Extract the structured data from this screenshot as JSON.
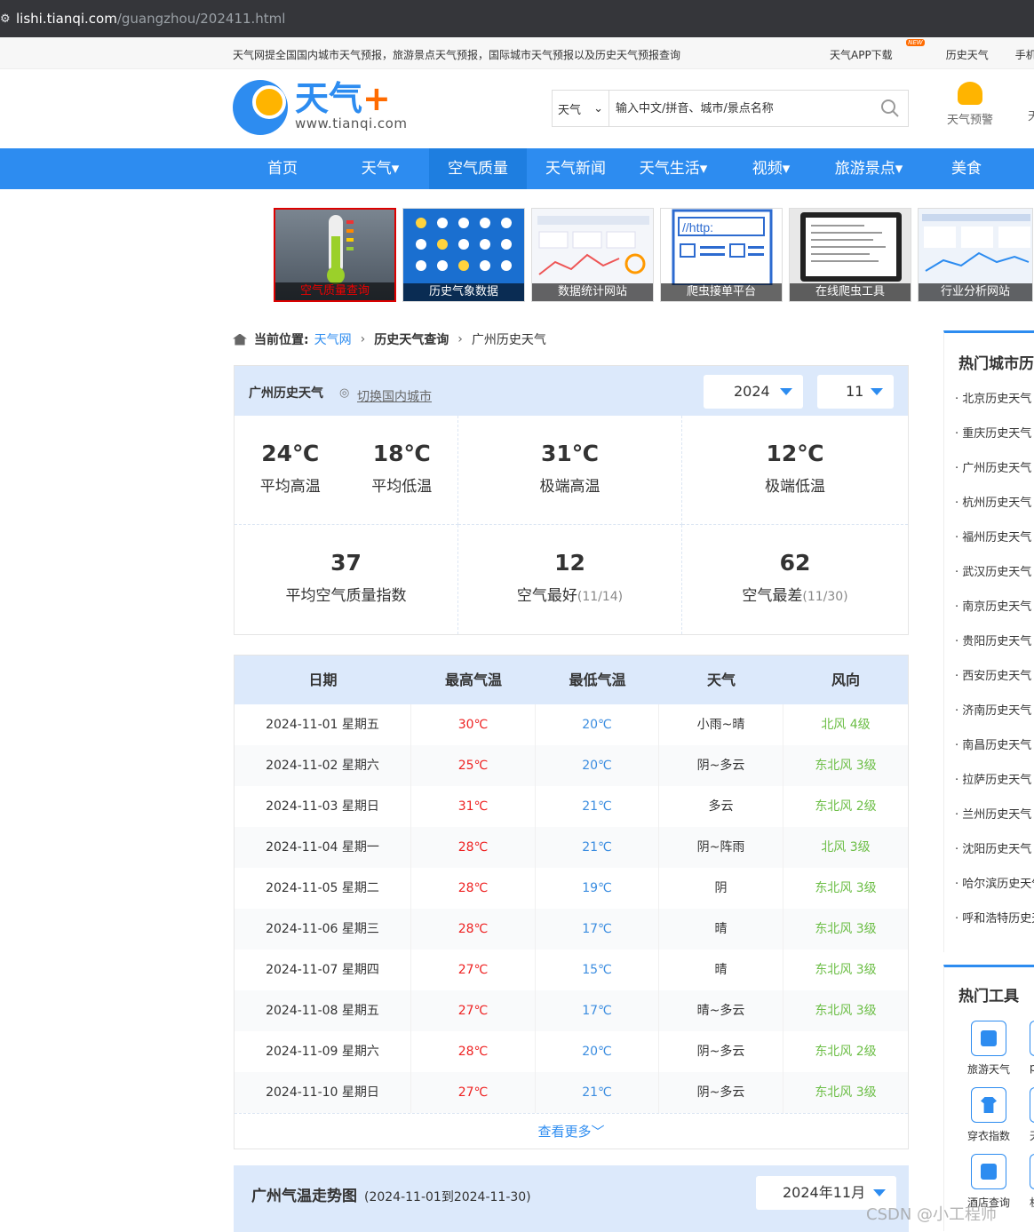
{
  "browser": {
    "domain": "lishi.tianqi.com",
    "path": "/guangzhou/202411.html"
  },
  "topbar": {
    "intro": "天气网提全国国内城市天气预报，旅游景点天气预报，国际城市天气预报以及历史天气预报查询",
    "links": [
      "天气APP下载",
      "历史天气",
      "手机天气"
    ],
    "new_badge": "NEW"
  },
  "logo": {
    "cn": "天气",
    "plus": "+",
    "url": "www.tianqi.com"
  },
  "search": {
    "select_value": "天气",
    "placeholder": "输入中文/拼音、城市/景点名称"
  },
  "header_actions": [
    "天气预警",
    "天"
  ],
  "nav": [
    "首页",
    "天气▾",
    "空气质量",
    "天气新闻",
    "天气生活▾",
    "视频▾",
    "旅游景点▾",
    "美食"
  ],
  "banners": [
    "空气质量查询",
    "历史气象数据",
    "数据统计网站",
    "爬虫接单平台",
    "在线爬虫工具",
    "行业分析网站"
  ],
  "breadcrumb": {
    "prefix": "当前位置:",
    "home": "天气网",
    "level2": "历史天气查询",
    "level3": "广州历史天气"
  },
  "panel": {
    "title": "广州历史天气",
    "switch_city": "切换国内城市",
    "year": "2024",
    "month": "11",
    "stats": {
      "avg_high": "24℃",
      "avg_high_label": "平均高温",
      "avg_low": "18℃",
      "avg_low_label": "平均低温",
      "extreme_high": "31℃",
      "extreme_high_label": "极端高温",
      "extreme_low": "12℃",
      "extreme_low_label": "极端低温",
      "avg_aqi": "37",
      "avg_aqi_label": "平均空气质量指数",
      "best_aqi": "12",
      "best_aqi_label": "空气最好",
      "best_date": "(11/14)",
      "worst_aqi": "62",
      "worst_aqi_label": "空气最差",
      "worst_date": "(11/30)"
    }
  },
  "table": {
    "headers": [
      "日期",
      "最高气温",
      "最低气温",
      "天气",
      "风向"
    ],
    "rows": [
      [
        "2024-11-01 星期五",
        "30℃",
        "20℃",
        "小雨~晴",
        "北风 4级"
      ],
      [
        "2024-11-02 星期六",
        "25℃",
        "20℃",
        "阴~多云",
        "东北风 3级"
      ],
      [
        "2024-11-03 星期日",
        "31℃",
        "21℃",
        "多云",
        "东北风 2级"
      ],
      [
        "2024-11-04 星期一",
        "28℃",
        "21℃",
        "阴~阵雨",
        "北风 3级"
      ],
      [
        "2024-11-05 星期二",
        "28℃",
        "19℃",
        "阴",
        "东北风 3级"
      ],
      [
        "2024-11-06 星期三",
        "28℃",
        "17℃",
        "晴",
        "东北风 3级"
      ],
      [
        "2024-11-07 星期四",
        "27℃",
        "15℃",
        "晴",
        "东北风 3级"
      ],
      [
        "2024-11-08 星期五",
        "27℃",
        "17℃",
        "晴~多云",
        "东北风 3级"
      ],
      [
        "2024-11-09 星期六",
        "28℃",
        "20℃",
        "阴~多云",
        "东北风 2级"
      ],
      [
        "2024-11-10 星期日",
        "27℃",
        "21℃",
        "阴~多云",
        "东北风 3级"
      ]
    ],
    "more": "查看更多"
  },
  "trend": {
    "title": "广州气温走势图",
    "range": "(2024-11-01到2024-11-30)",
    "month": "2024年11月"
  },
  "sidebar": {
    "title": "热门城市历",
    "cities": [
      "北京历史天气",
      "重庆历史天气",
      "广州历史天气",
      "杭州历史天气",
      "福州历史天气",
      "武汉历史天气",
      "南京历史天气",
      "贵阳历史天气",
      "西安历史天气",
      "济南历史天气",
      "南昌历史天气",
      "拉萨历史天气",
      "兰州历史天气",
      "沈阳历史天气",
      "哈尔滨历史天气",
      "呼和浩特历史天气"
    ]
  },
  "tools": {
    "title": "热门工具",
    "items": [
      "旅游天气",
      "穿衣指数",
      "酒店查询"
    ],
    "items_partial": [
      "pm",
      "天",
      "机"
    ]
  },
  "watermark": "CSDN @小工程师",
  "colors": {
    "primary": "#2d8cf0",
    "hot": "#ee2222",
    "cold": "#3b8de0",
    "wind": "#6cbe46"
  }
}
